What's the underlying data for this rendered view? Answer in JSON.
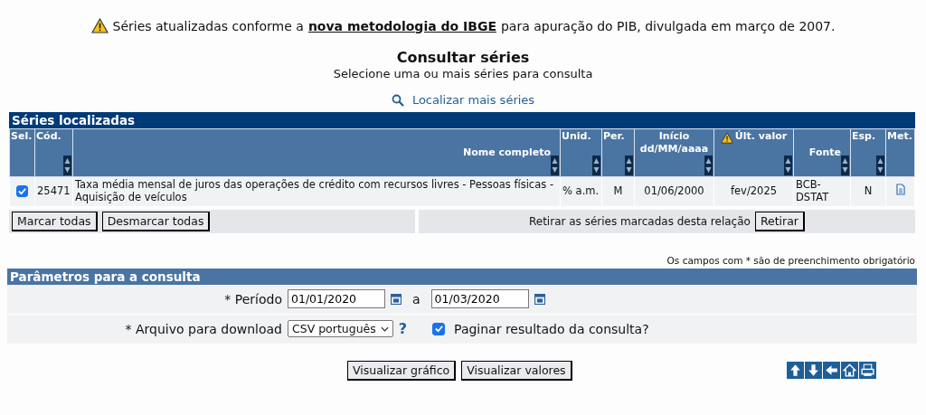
{
  "notice": {
    "before": "Séries atualizadas conforme a",
    "link": "nova metodologia do IBGE",
    "after": "para apuração do PIB, divulgada em março de 2007."
  },
  "title": "Consultar séries",
  "subtitle": "Selecione uma ou mais séries para consulta",
  "find_link": "Localizar mais séries",
  "series_table": {
    "caption": "Séries localizadas",
    "columns": [
      {
        "label": "Sel.",
        "sortable": false
      },
      {
        "label": "Cód.",
        "sortable": true
      },
      {
        "label": "Nome completo",
        "sortable": true
      },
      {
        "label": "Unid.",
        "sortable": true
      },
      {
        "label": "Per.",
        "sortable": true
      },
      {
        "label": "Início",
        "sublabel": "dd/MM/aaaa",
        "sortable": true
      },
      {
        "label": "Últ. valor",
        "warning": true,
        "sortable": true
      },
      {
        "label": "Fonte",
        "sortable": true
      },
      {
        "label": "Esp.",
        "sortable": true
      },
      {
        "label": "Met.",
        "sortable": false
      }
    ],
    "rows": [
      {
        "selected": true,
        "code": "25471",
        "name": "Taxa média mensal de juros das operações de crédito com recursos livres - Pessoas físicas - Aquisição de veículos",
        "unit": "% a.m.",
        "period": "M",
        "start": "01/06/2000",
        "last": "fev/2025",
        "source": "BCB-DSTAT",
        "special": "N"
      }
    ]
  },
  "buttons_left": [
    "Marcar todas",
    "Desmarcar todas"
  ],
  "remove_text": "Retirar as séries marcadas desta relação",
  "remove_button": "Retirar",
  "required_note": "Os campos com * são de preenchimento obrigatório",
  "params": {
    "caption": "Parâmetros para a consulta",
    "period_label": "* Período",
    "date_from": "01/01/2020",
    "date_sep": "a",
    "date_to": "01/03/2020",
    "file_label": "* Arquivo para download",
    "file_format": "CSV português",
    "help": "?",
    "paginate": {
      "label": "Paginar resultado da consulta?",
      "checked": true
    }
  },
  "actions": [
    "Visualizar gráfico",
    "Visualizar valores"
  ]
}
